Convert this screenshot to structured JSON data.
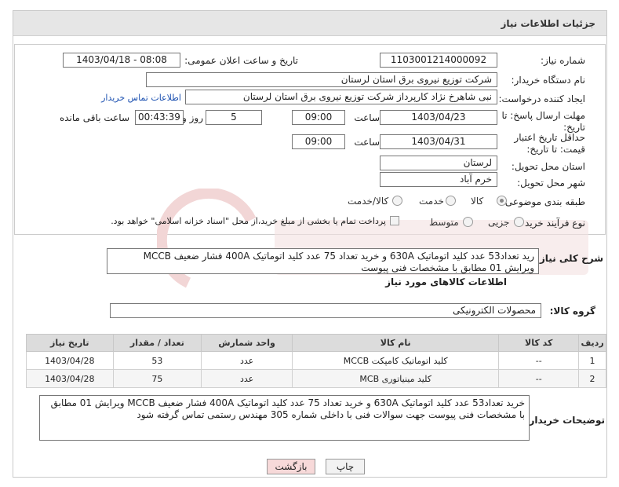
{
  "header": {
    "title": "جزئیات اطلاعات نیاز"
  },
  "form": {
    "need_number_label": "شماره نیاز:",
    "need_number": "1103001214000092",
    "announce_label": "تاریخ و ساعت اعلان عمومی:",
    "announce_value": "1403/04/18 - 08:08",
    "buyer_label": "نام دستگاه خریدار:",
    "buyer_value": "شرکت توزیع نیروی برق استان لرستان",
    "creator_label": "ایجاد کننده درخواست:",
    "creator_value": "نبی شاهرخ نژاد کارپرداز شرکت توزیع نیروی برق استان لرستان",
    "contact_link": "اطلاعات تماس خریدار",
    "deadline_label": "مهلت ارسال پاسخ: تا تاریخ:",
    "deadline_date": "1403/04/23",
    "time_label": "ساعت",
    "deadline_time": "09:00",
    "days_value": "5",
    "days_label": "روز و",
    "remaining_time": "00:43:39",
    "remaining_label": "ساعت باقی مانده",
    "validity_label": "حداقل تاریخ اعتبار قیمت: تا تاریخ:",
    "validity_date": "1403/04/31",
    "validity_time": "09:00",
    "province_label": "استان محل تحویل:",
    "province_value": "لرستان",
    "city_label": "شهر محل تحویل:",
    "city_value": "خرم آباد",
    "category_label": "طبقه بندی موضوعی:",
    "category_options": [
      "کالا",
      "خدمت",
      "کالا/خدمت"
    ],
    "category_selected": "کالا",
    "process_label": "نوع فرآیند خرید :",
    "process_options": [
      "جزیی",
      "متوسط"
    ],
    "payment_note": "پرداخت تمام یا بخشی از مبلغ خرید،از محل \"اسناد خزانه اسلامی\" خواهد بود."
  },
  "description": {
    "label": "شرح کلی نیاز:",
    "text": "رید تعداد53 عدد کلید اتوماتیک 630A  و خرید تعداد 75 عدد کلید اتوماتیک 400A فشار ضعیف MCCB ویرایش 01 مطابق با مشخصات فنی پیوست"
  },
  "goods": {
    "section_title": "اطلاعات کالاهای مورد نیاز",
    "group_label": "گروه کالا:",
    "group_value": "محصولات الکترونیکی",
    "columns": [
      "ردیف",
      "کد کالا",
      "نام کالا",
      "واحد شمارش",
      "تعداد / مقدار",
      "تاریخ نیاز"
    ],
    "rows": [
      [
        "1",
        "--",
        "کلید اتوماتیک کامپکت MCCB",
        "عدد",
        "53",
        "1403/04/28"
      ],
      [
        "2",
        "--",
        "کلید مینیاتوری MCB",
        "عدد",
        "75",
        "1403/04/28"
      ]
    ]
  },
  "buyer_notes": {
    "label": "توضیحات خریدار:",
    "text": "خرید تعداد53 عدد کلید اتوماتیک 630A و خرید تعداد 75 عدد کلید اتوماتیک 400A   فشار ضعیف MCCB ویرایش 01 مطابق با مشخصات فنی پیوست جهت سوالات فنی با داخلی شماره 305 مهندس رستمی تماس گرفته شود"
  },
  "buttons": {
    "print": "چاپ",
    "back": "بازگشت"
  },
  "colors": {
    "link": "#1a4fb0",
    "back_button_bg": "#f7d9d9",
    "header_bg": "#e6e6e6"
  }
}
